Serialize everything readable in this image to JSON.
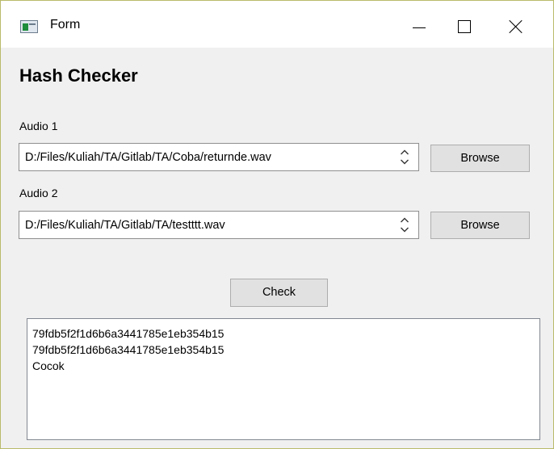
{
  "window": {
    "title": "Form",
    "controls": {
      "minimize": "minimize",
      "maximize": "maximize",
      "close": "close"
    }
  },
  "form": {
    "heading": "Hash Checker",
    "audio1": {
      "label": "Audio 1",
      "path": "D:/Files/Kuliah/TA/Gitlab/TA/Coba/returnde.wav",
      "browse_label": "Browse"
    },
    "audio2": {
      "label": "Audio 2",
      "path": "D:/Files/Kuliah/TA/Gitlab/TA/testttt.wav",
      "browse_label": "Browse"
    },
    "check_label": "Check",
    "output_lines": [
      "79fdb5f2f1d6b6a3441785e1eb354b15",
      "79fdb5f2f1d6b6a3441785e1eb354b15",
      "Cocok"
    ]
  },
  "icons": {
    "app": "form-window-icon",
    "spinner": "up-down-arrows-icon"
  },
  "colors": {
    "window_bg": "#f0f0f0",
    "button_bg": "#e1e1e1",
    "window_border": "#b9b96a"
  }
}
